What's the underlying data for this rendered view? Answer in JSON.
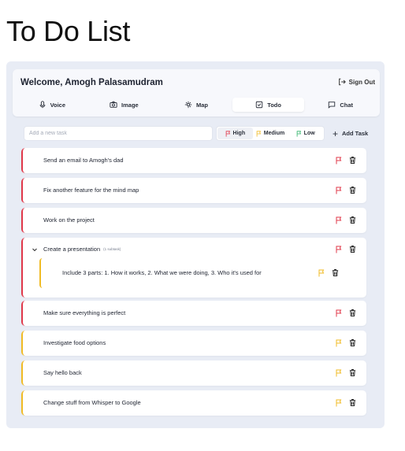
{
  "page": {
    "heading": "To Do List"
  },
  "header": {
    "welcome": "Welcome, Amogh Palasamudram",
    "sign_out": "Sign Out"
  },
  "tabs": [
    {
      "label": "Voice",
      "icon": "mic-icon"
    },
    {
      "label": "Image",
      "icon": "camera-icon"
    },
    {
      "label": "Map",
      "icon": "mind-map-icon"
    },
    {
      "label": "Todo",
      "icon": "checkbox-icon",
      "active": true
    },
    {
      "label": "Chat",
      "icon": "chat-bubble-icon"
    }
  ],
  "new_task": {
    "placeholder": "Add a new task",
    "priorities": [
      {
        "label": "High",
        "color": "#e0384a",
        "selected": true
      },
      {
        "label": "Medium",
        "color": "#f0bb25"
      },
      {
        "label": "Low",
        "color": "#2fb36a"
      }
    ],
    "add_label": "Add Task"
  },
  "colors": {
    "high": "#e0384a",
    "medium": "#f0bb25",
    "low": "#2fb36a"
  },
  "tasks": [
    {
      "text": "Send an email to Amogh's dad",
      "priority": "high"
    },
    {
      "text": "Fix another feature for the mind map",
      "priority": "high"
    },
    {
      "text": "Work on the project",
      "priority": "high"
    },
    {
      "text": "Create a presentation",
      "priority": "high",
      "subtask_count": "(1 subtask)",
      "expanded": true,
      "subtasks": [
        {
          "text": "Include 3 parts: 1. How it works, 2. What we were doing, 3. Who it's used for",
          "priority": "medium"
        }
      ]
    },
    {
      "text": "Make sure everything is perfect",
      "priority": "high"
    },
    {
      "text": "Investigate food options",
      "priority": "medium"
    },
    {
      "text": "Say hello back",
      "priority": "medium"
    },
    {
      "text": "Change stuff from Whisper to Google",
      "priority": "medium"
    }
  ]
}
